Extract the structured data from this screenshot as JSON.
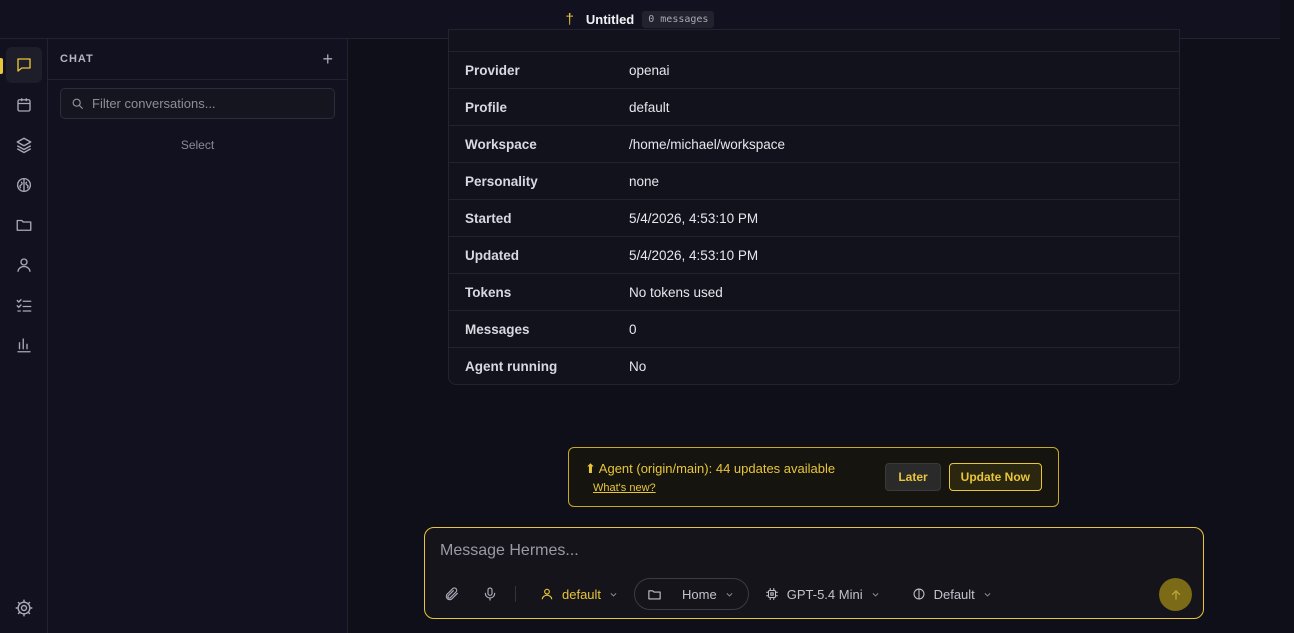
{
  "topbar": {
    "glyph": "†",
    "title": "Untitled",
    "message_count": "0 messages"
  },
  "rail": {
    "items": [
      {
        "icon": "chat-icon",
        "active": true
      },
      {
        "icon": "calendar-icon"
      },
      {
        "icon": "layers-icon"
      },
      {
        "icon": "brain-icon"
      },
      {
        "icon": "folder-icon"
      },
      {
        "icon": "user-icon"
      },
      {
        "icon": "checklist-icon"
      },
      {
        "icon": "bar-chart-icon"
      }
    ],
    "bottom": "gear-icon"
  },
  "sidebar": {
    "title": "CHAT",
    "new_label": "+",
    "filter_placeholder": "Filter conversations...",
    "empty_hint": "Select"
  },
  "session": {
    "rows": [
      {
        "key": "Provider",
        "value": "openai"
      },
      {
        "key": "Profile",
        "value": "default"
      },
      {
        "key": "Workspace",
        "value": "/home/michael/workspace"
      },
      {
        "key": "Personality",
        "value": "none"
      },
      {
        "key": "Started",
        "value": "5/4/2026, 4:53:10 PM"
      },
      {
        "key": "Updated",
        "value": "5/4/2026, 4:53:10 PM"
      },
      {
        "key": "Tokens",
        "value": "No tokens used"
      },
      {
        "key": "Messages",
        "value": "0"
      },
      {
        "key": "Agent running",
        "value": "No"
      }
    ]
  },
  "banner": {
    "message": "⬆ Agent (origin/main): 44 updates available",
    "link": "What's new?",
    "later": "Later",
    "update": "Update Now"
  },
  "composer": {
    "placeholder": "Message Hermes...",
    "profile": "default",
    "folder": "Home",
    "model": "GPT-5.4 Mini",
    "personality": "Default"
  },
  "colors": {
    "accent": "#e8c53a",
    "background": "#0f0f19",
    "panel": "#111120"
  }
}
